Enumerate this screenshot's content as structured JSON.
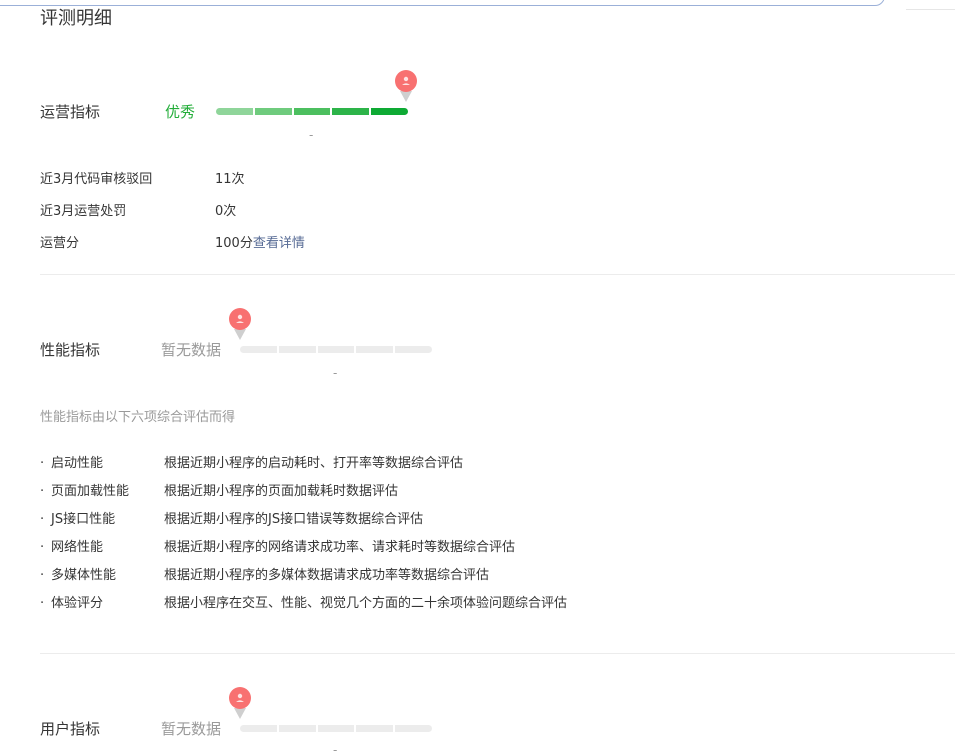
{
  "page_title": "评测明细",
  "colors": {
    "good": "#23ad39",
    "muted": "#9a9a9a",
    "link": "#576b95",
    "pin": "#f87171",
    "bar_good": [
      "#8fd59a",
      "#6fcb7d",
      "#4cbf5f",
      "#2db449",
      "#0eaa34"
    ],
    "bar_none": "#ececec"
  },
  "operation": {
    "label": "运营指标",
    "level": "优秀",
    "score_caption": "-",
    "rows": [
      {
        "key": "近3月代码审核驳回",
        "value": "11次"
      },
      {
        "key": "近3月运营处罚",
        "value": "0次"
      },
      {
        "key": "运营分",
        "value": "100分",
        "link": "查看详情"
      }
    ]
  },
  "performance": {
    "label": "性能指标",
    "level": "暂无数据",
    "score_caption": "-",
    "description": "性能指标由以下六项综合评估而得",
    "items": [
      {
        "bullet": "·",
        "name": "启动性能",
        "desc": "根据近期小程序的启动耗时、打开率等数据综合评估"
      },
      {
        "bullet": "·",
        "name": "页面加载性能",
        "desc": "根据近期小程序的页面加载耗时数据评估"
      },
      {
        "bullet": "·",
        "name": "JS接口性能",
        "desc": "根据近期小程序的JS接口错误等数据综合评估"
      },
      {
        "bullet": "·",
        "name": "网络性能",
        "desc": "根据近期小程序的网络请求成功率、请求耗时等数据综合评估"
      },
      {
        "bullet": "·",
        "name": "多媒体性能",
        "desc": "根据近期小程序的多媒体数据请求成功率等数据综合评估"
      },
      {
        "bullet": "·",
        "name": "体验评分",
        "desc": "根据小程序在交互、性能、视觉几个方面的二十余项体验问题综合评估"
      }
    ]
  },
  "user": {
    "label": "用户指标",
    "level": "暂无数据",
    "score_caption": "-"
  }
}
